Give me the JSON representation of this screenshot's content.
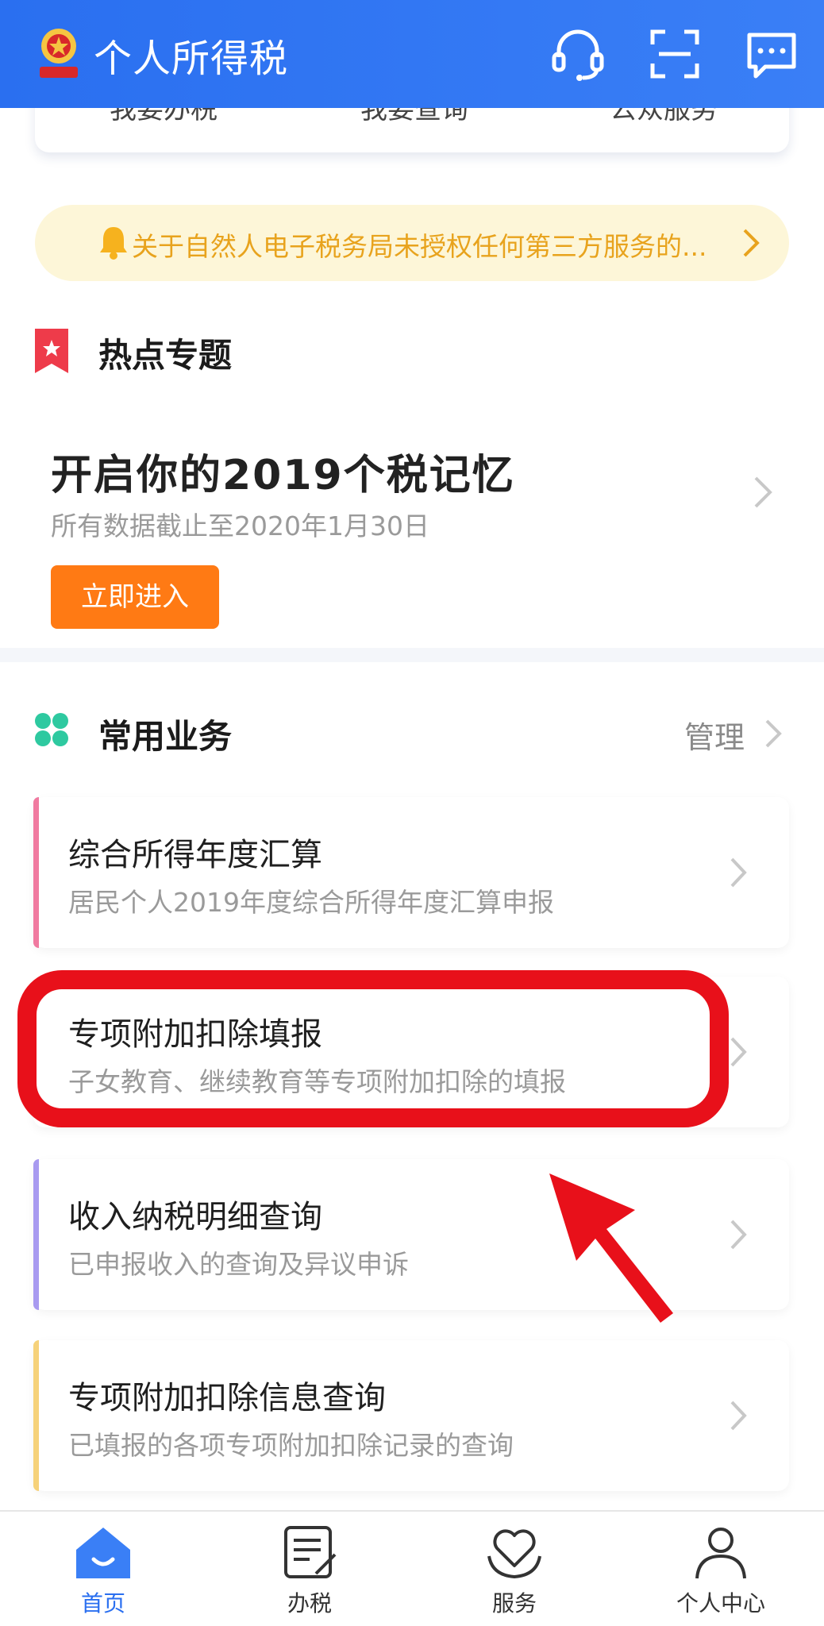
{
  "header": {
    "title": "个人所得税",
    "icons": [
      "customer-service-icon",
      "scan-icon",
      "message-icon"
    ]
  },
  "quick_actions": [
    "我要办税",
    "我要查询",
    "公众服务"
  ],
  "notice": {
    "text": "关于自然人电子税务局未授权任何第三方服务的...",
    "icon": "bell-icon"
  },
  "hot_topics": {
    "title": "热点专题",
    "promo_title": "开启你的2019个税记忆",
    "promo_subtitle": "所有数据截止至2020年1月30日",
    "promo_button": "立即进入"
  },
  "common_business": {
    "title": "常用业务",
    "manage_label": "管理",
    "items": [
      {
        "title": "综合所得年度汇算",
        "desc": "居民个人2019年度综合所得年度汇算申报",
        "accent": "#f07aa0"
      },
      {
        "title": "专项附加扣除填报",
        "desc": "子女教育、继续教育等专项附加扣除的填报",
        "accent": "#ffffff"
      },
      {
        "title": "收入纳税明细查询",
        "desc": "已申报收入的查询及异议申诉",
        "accent": "#a89af0"
      },
      {
        "title": "专项附加扣除信息查询",
        "desc": "已填报的各项专项附加扣除记录的查询",
        "accent": "#f6d27a"
      }
    ]
  },
  "tabbar": {
    "tabs": [
      {
        "label": "首页",
        "icon": "home-icon",
        "active": true
      },
      {
        "label": "办税",
        "icon": "tax-form-icon",
        "active": false
      },
      {
        "label": "服务",
        "icon": "service-heart-icon",
        "active": false
      },
      {
        "label": "个人中心",
        "icon": "user-icon",
        "active": false
      }
    ]
  },
  "colors": {
    "primary": "#2a6ff0",
    "notice_bg": "#fdf6d8",
    "notice_text": "#e8a31d",
    "promo_button": "#ff7a14",
    "highlight": "#e8101a"
  }
}
